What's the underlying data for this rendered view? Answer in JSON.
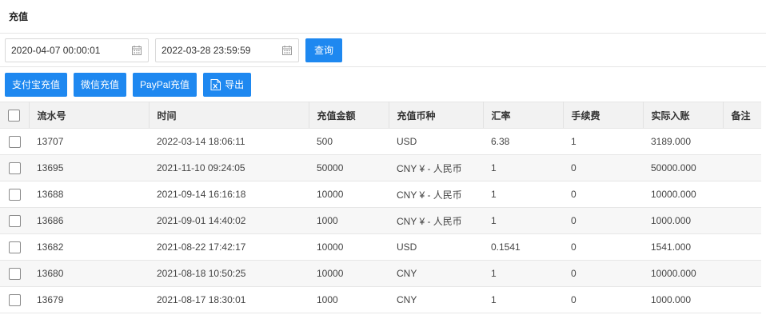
{
  "page": {
    "title": "充值"
  },
  "filters": {
    "start_date": "2020-04-07 00:00:01",
    "end_date": "2022-03-28 23:59:59",
    "query_label": "查询"
  },
  "actions": {
    "alipay_label": "支付宝充值",
    "wechat_label": "微信充值",
    "paypal_label": "PayPal充值",
    "export_label": "导出"
  },
  "colors": {
    "primary": "#1e88f0",
    "header_bg": "#f2f2f2",
    "alt_row_bg": "#f7f7f7",
    "border": "#e6e6e6"
  },
  "table": {
    "headers": [
      "流水号",
      "时间",
      "充值金额",
      "充值币种",
      "汇率",
      "手续费",
      "实际入账",
      "备注"
    ],
    "rows": [
      {
        "id": "13707",
        "time": "2022-03-14 18:06:11",
        "amount": "500",
        "currency": "USD",
        "rate": "6.38",
        "fee": "1",
        "credited": "3189.000",
        "note": ""
      },
      {
        "id": "13695",
        "time": "2021-11-10 09:24:05",
        "amount": "50000",
        "currency": "CNY ¥ - 人民币",
        "rate": "1",
        "fee": "0",
        "credited": "50000.000",
        "note": ""
      },
      {
        "id": "13688",
        "time": "2021-09-14 16:16:18",
        "amount": "10000",
        "currency": "CNY ¥ - 人民币",
        "rate": "1",
        "fee": "0",
        "credited": "10000.000",
        "note": ""
      },
      {
        "id": "13686",
        "time": "2021-09-01 14:40:02",
        "amount": "1000",
        "currency": "CNY ¥ - 人民币",
        "rate": "1",
        "fee": "0",
        "credited": "1000.000",
        "note": ""
      },
      {
        "id": "13682",
        "time": "2021-08-22 17:42:17",
        "amount": "10000",
        "currency": "USD",
        "rate": "0.1541",
        "fee": "0",
        "credited": "1541.000",
        "note": ""
      },
      {
        "id": "13680",
        "time": "2021-08-18 10:50:25",
        "amount": "10000",
        "currency": "CNY",
        "rate": "1",
        "fee": "0",
        "credited": "10000.000",
        "note": ""
      },
      {
        "id": "13679",
        "time": "2021-08-17 18:30:01",
        "amount": "1000",
        "currency": "CNY",
        "rate": "1",
        "fee": "0",
        "credited": "1000.000",
        "note": ""
      }
    ]
  }
}
